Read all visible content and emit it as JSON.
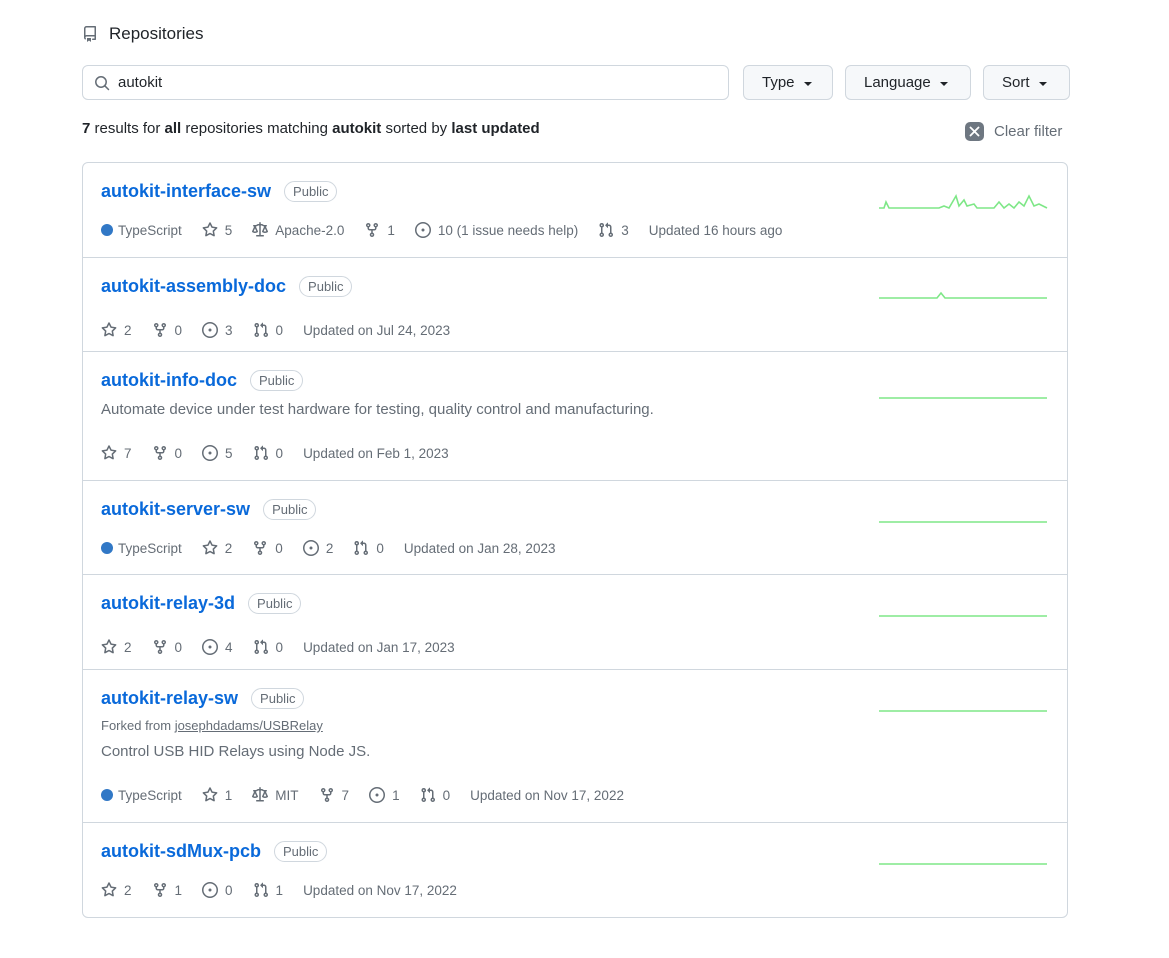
{
  "header": {
    "title": "Repositories",
    "icon": "repo-icon"
  },
  "search": {
    "value": "autokit",
    "icon": "search-icon"
  },
  "filters": {
    "type_label": "Type",
    "language_label": "Language",
    "sort_label": "Sort"
  },
  "summary": {
    "count": "7",
    "text1": " results for ",
    "scope": "all",
    "text2": " repositories matching ",
    "query": "autokit",
    "text3": " sorted by ",
    "sort": "last updated"
  },
  "clear_filter": {
    "label": "Clear filter",
    "icon": "close-icon"
  },
  "colors": {
    "link": "#0969da",
    "typescript": "#3178c6",
    "spark": "#7ee787"
  },
  "repos": [
    {
      "name": "autokit-interface-sw",
      "visibility": "Public",
      "language": "TypeScript",
      "stars": "5",
      "license": "Apache-2.0",
      "forks": "1",
      "issues": "10 (1 issue needs help)",
      "prs": "3",
      "updated": "Updated 16 hours ago"
    },
    {
      "name": "autokit-assembly-doc",
      "visibility": "Public",
      "stars": "2",
      "forks": "0",
      "issues": "3",
      "prs": "0",
      "updated": "Updated on Jul 24, 2023"
    },
    {
      "name": "autokit-info-doc",
      "visibility": "Public",
      "description": "Automate device under test hardware for testing, quality control and manufacturing.",
      "stars": "7",
      "forks": "0",
      "issues": "5",
      "prs": "0",
      "updated": "Updated on Feb 1, 2023"
    },
    {
      "name": "autokit-server-sw",
      "visibility": "Public",
      "language": "TypeScript",
      "stars": "2",
      "forks": "0",
      "issues": "2",
      "prs": "0",
      "updated": "Updated on Jan 28, 2023"
    },
    {
      "name": "autokit-relay-3d",
      "visibility": "Public",
      "stars": "2",
      "forks": "0",
      "issues": "4",
      "prs": "0",
      "updated": "Updated on Jan 17, 2023"
    },
    {
      "name": "autokit-relay-sw",
      "visibility": "Public",
      "forked_prefix": "Forked from ",
      "forked_from": "josephdadams/USBRelay",
      "description": "Control USB HID Relays using Node JS.",
      "language": "TypeScript",
      "stars": "1",
      "license": "MIT",
      "forks": "7",
      "issues": "1",
      "prs": "0",
      "updated": "Updated on Nov 17, 2022"
    },
    {
      "name": "autokit-sdMux-pcb",
      "visibility": "Public",
      "stars": "2",
      "forks": "1",
      "issues": "0",
      "prs": "1",
      "updated": "Updated on Nov 17, 2022"
    }
  ]
}
